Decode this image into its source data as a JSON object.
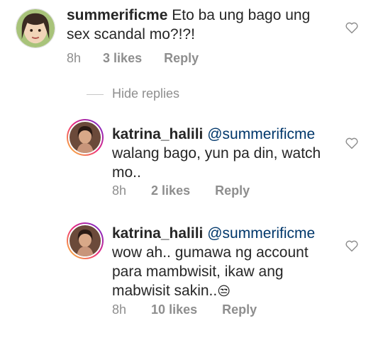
{
  "comments": [
    {
      "username": "summerificme",
      "text": "Eto ba ung bago ung sex scandal mo?!?!",
      "time": "8h",
      "likes": "3 likes",
      "reply": "Reply"
    }
  ],
  "hide_replies": "Hide replies",
  "replies": [
    {
      "username": "katrina_halili",
      "mention": "@summerificme",
      "text": "walang bago, yun pa din, watch mo..",
      "time": "8h",
      "likes": "2 likes",
      "reply": "Reply"
    },
    {
      "username": "katrina_halili",
      "mention": "@summerificme",
      "text": "wow ah.. gumawa ng account para mambwisit, ikaw ang mabwisit sakin..",
      "text_emoji": "😒",
      "time": "8h",
      "likes": "10 likes",
      "reply": "Reply"
    }
  ],
  "icons": {
    "avatar_main": "avatar",
    "avatar_reply": "avatar-story-ring",
    "like": "heart-outline-icon"
  },
  "colors": {
    "text": "#262626",
    "secondary": "#8e8e8e",
    "mention": "#00376b",
    "ring": "#ee2a7b"
  }
}
